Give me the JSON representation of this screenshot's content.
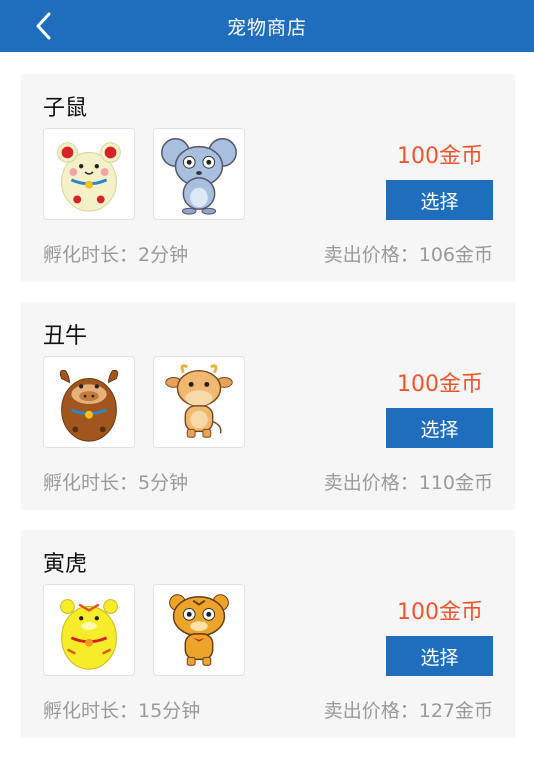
{
  "header": {
    "title": "宠物商店"
  },
  "pets": [
    {
      "name": "子鼠",
      "price": "100金币",
      "select_label": "选择",
      "hatch_label": "孵化时长：",
      "hatch_value": "2分钟",
      "sell_label": "卖出价格：",
      "sell_value": "106金币",
      "egg_icon": "mouse-egg-icon",
      "animal_icon": "mouse-icon"
    },
    {
      "name": "丑牛",
      "price": "100金币",
      "select_label": "选择",
      "hatch_label": "孵化时长：",
      "hatch_value": "5分钟",
      "sell_label": "卖出价格：",
      "sell_value": "110金币",
      "egg_icon": "ox-egg-icon",
      "animal_icon": "ox-icon"
    },
    {
      "name": "寅虎",
      "price": "100金币",
      "select_label": "选择",
      "hatch_label": "孵化时长：",
      "hatch_value": "15分钟",
      "sell_label": "卖出价格：",
      "sell_value": "127金币",
      "egg_icon": "tiger-egg-icon",
      "animal_icon": "tiger-icon"
    }
  ],
  "colors": {
    "header": "#1f6ebd",
    "price": "#f2542d",
    "button": "#1f6ebd"
  }
}
